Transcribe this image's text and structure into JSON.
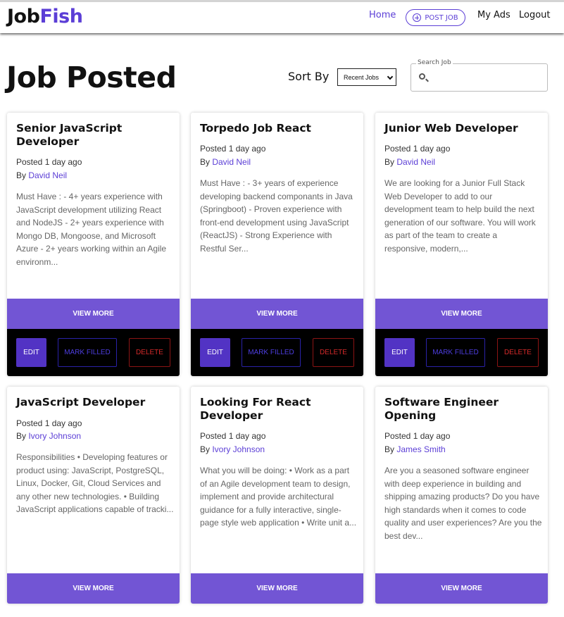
{
  "header": {
    "logo_part1": "Job",
    "logo_part2": "Fish",
    "nav_home": "Home",
    "nav_post_job": "POST JOB",
    "nav_my_ads": "My Ads",
    "nav_logout": "Logout"
  },
  "main": {
    "title": "Job Posted",
    "sort_label": "Sort By",
    "sort_selected": "Recent Jobs",
    "search_label": "Search Job"
  },
  "actions": {
    "view_more": "VIEW MORE",
    "edit": "EDIT",
    "mark_filled": "MARK FILLED",
    "delete": "DELETE"
  },
  "jobs": [
    {
      "title": "Senior JavaScript Developer",
      "posted": "Posted 1 day ago",
      "by": "By ",
      "author": "David Neil",
      "description": "Must Have : - 4+ years experience with JavaScript development utilizing React and NodeJS - 2+ years experience with Mongo DB, Mongoose, and Microsoft Azure - 2+ years working within an Agile environm..."
    },
    {
      "title": "Torpedo Job React",
      "posted": "Posted 1 day ago",
      "by": "By ",
      "author": "David Neil",
      "description": "Must Have : - 3+ years of experience developing backend componants in Java (Springboot) - Proven experience with front-end development using JavaScript (ReactJS) - Strong Experience with Restful Ser..."
    },
    {
      "title": "Junior Web Developer",
      "posted": "Posted 1 day ago",
      "by": "By ",
      "author": "David Neil",
      "description": "We are looking for a Junior Full Stack Web Developer to add to our development team to help build the next generation of our software. You will work as part of the team to create a responsive, modern,..."
    },
    {
      "title": "JavaScript Developer",
      "posted": "Posted 1 day ago",
      "by": "By ",
      "author": "Ivory Johnson",
      "description": "Responsibilities • Developing features or product using: JavaScript, PostgreSQL, Linux, Docker, Git, Cloud Services and any other new technologies. • Building JavaScript applications capable of tracki..."
    },
    {
      "title": "Looking For React Developer",
      "posted": "Posted 1 day ago",
      "by": "By ",
      "author": "Ivory Johnson",
      "description": "What you will be doing: • Work as a part of an Agile development team to design, implement and provide architectural guidance for a fully interactive, single-page style web application • Write unit a..."
    },
    {
      "title": "Software Engineer Opening",
      "posted": "Posted 1 day ago",
      "by": "By ",
      "author": "James Smith",
      "description": "Are you a seasoned software engineer with deep experience in building and shipping amazing products? Do you have high standards when it comes to code quality and user experiences? Are you the best dev..."
    }
  ]
}
